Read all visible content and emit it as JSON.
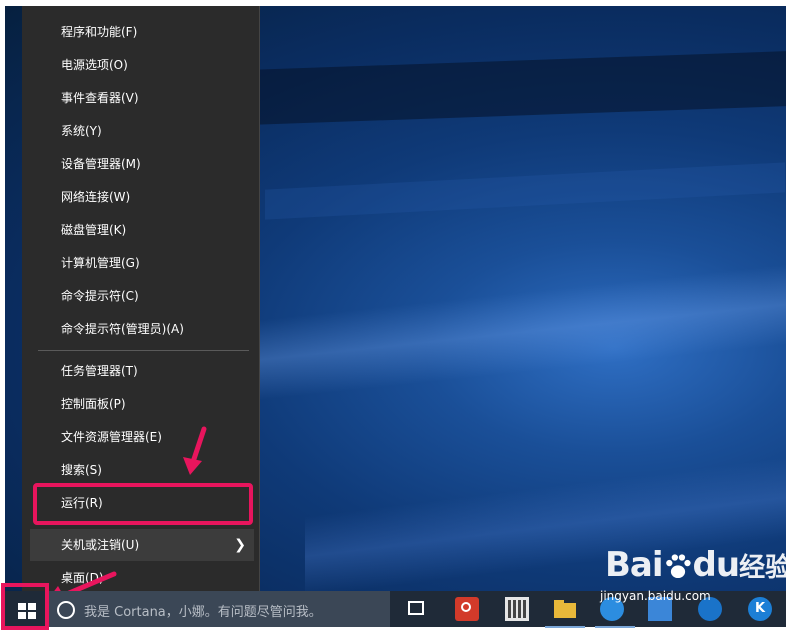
{
  "context_menu": {
    "items": [
      {
        "label": "程序和功能(F)"
      },
      {
        "label": "电源选项(O)"
      },
      {
        "label": "事件查看器(V)"
      },
      {
        "label": "系统(Y)"
      },
      {
        "label": "设备管理器(M)"
      },
      {
        "label": "网络连接(W)"
      },
      {
        "label": "磁盘管理(K)"
      },
      {
        "label": "计算机管理(G)"
      },
      {
        "label": "命令提示符(C)"
      },
      {
        "label": "命令提示符(管理员)(A)"
      },
      {
        "label": "任务管理器(T)"
      },
      {
        "label": "控制面板(P)"
      },
      {
        "label": "文件资源管理器(E)"
      },
      {
        "label": "搜索(S)"
      },
      {
        "label": "运行(R)",
        "highlighted_by_callout": true
      },
      {
        "label": "关机或注销(U)",
        "has_submenu": true
      },
      {
        "label": "桌面(D)"
      }
    ]
  },
  "taskbar": {
    "search_placeholder": "我是 Cortana，小娜。有问题尽管问我。",
    "pinned_icons": [
      "task-view-icon",
      "power-app-icon",
      "calculator-icon",
      "file-explorer-icon",
      "app-icon-1",
      "app-icon-2",
      "app-icon-3",
      "k-app-icon"
    ],
    "k_app_letter": "K"
  },
  "watermark": {
    "brand_latin": "Bai",
    "brand_latin2": "du",
    "brand_cn": "经验",
    "url": "jingyan.baidu.com"
  },
  "colors": {
    "menu_bg": "#2b2b2b",
    "callout": "#e8155d",
    "desktop": "#0f3a78",
    "taskbar": "#1f2a38"
  }
}
